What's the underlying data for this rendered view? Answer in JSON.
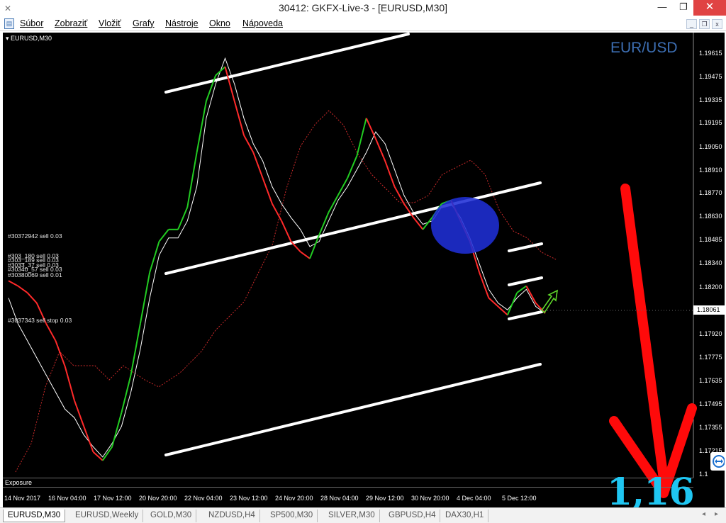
{
  "window": {
    "title": "30412: GKFX-Live-3 - [EURUSD,M30]",
    "icon": "app-icon",
    "controls": {
      "minimize": "—",
      "restore": "❐",
      "close": "✕"
    }
  },
  "menu": {
    "items": [
      "Súbor",
      "Zobraziť",
      "Vložiť",
      "Grafy",
      "Nástroje",
      "Okno",
      "Nápoveda"
    ],
    "mdi": {
      "minimize": "_",
      "restore": "❐",
      "close": "x"
    }
  },
  "chart": {
    "symbol_label": "EURUSD,M30",
    "watermark": "EUR/USD",
    "current_price": "1.18061",
    "exposure_label": "Exposure",
    "overlay_price": "1,16",
    "trade_labels": [
      "#30372942 sell 0.03",
      "#303_180 sell 0.03",
      "#303_189 sell 0.03",
      "#3033_37 sell 0.03",
      "#30340_57 sell 0.03",
      "#30380069 sell 0.01",
      "#3037343 sell stop 0.03"
    ],
    "colors": {
      "background": "#000000",
      "bull_candle": "#22cc22",
      "bear_candle": "#ff2a2a",
      "line": "#ffffff",
      "highlight": "#1f2fd6",
      "arrow": "#ff0a0a",
      "overlay_price": "#1fc6f2"
    }
  },
  "chart_data": {
    "type": "line",
    "title": "",
    "y_ticks": [
      "1.19615",
      "1.19475",
      "1.19335",
      "1.19195",
      "1.19050",
      "1.18910",
      "1.18770",
      "1.18630",
      "1.18485",
      "1.18340",
      "1.18200",
      "1.18061",
      "1.17920",
      "1.17775",
      "1.17635",
      "1.17495",
      "1.17355",
      "1.17215",
      "1.1"
    ],
    "x_ticks": [
      "14 Nov 2017",
      "16 Nov 04:00",
      "17 Nov 12:00",
      "20 Nov 20:00",
      "22 Nov 04:00",
      "23 Nov 12:00",
      "24 Nov 20:00",
      "28 Nov 04:00",
      "29 Nov 12:00",
      "30 Nov 20:00",
      "4 Dec 04:00",
      "5 Dec 12:00"
    ],
    "ylim": [
      1.171,
      1.197
    ],
    "series": [
      {
        "values": [
          1.1815,
          1.18,
          1.179,
          1.178,
          1.177,
          1.176,
          1.175,
          1.1745,
          1.1735,
          1.1728,
          1.1722,
          1.173,
          1.174,
          1.176,
          1.1785,
          1.1815,
          1.184,
          1.185,
          1.185,
          1.186,
          1.188,
          1.192,
          1.194,
          1.1955,
          1.194,
          1.192,
          1.1905,
          1.1895,
          1.188,
          1.187,
          1.1862,
          1.1855,
          1.1845,
          1.1848,
          1.186,
          1.1872,
          1.188,
          1.189,
          1.19,
          1.1912,
          1.1905,
          1.189,
          1.1875,
          1.1865,
          1.1858,
          1.186,
          1.1868,
          1.187,
          1.1862,
          1.185,
          1.1835,
          1.182,
          1.1812,
          1.1808,
          1.1815,
          1.182,
          1.181,
          1.1806
        ]
      },
      {
        "values": [
          1.1825,
          1.1822,
          1.1818,
          1.1812,
          1.18,
          1.179,
          1.1775,
          1.1755,
          1.174,
          1.1725,
          1.172,
          1.1728,
          1.1748,
          1.177,
          1.18,
          1.183,
          1.1848,
          1.1855,
          1.1855,
          1.1868,
          1.19,
          1.193,
          1.1945,
          1.195,
          1.193,
          1.191,
          1.19,
          1.1885,
          1.187,
          1.186,
          1.1848,
          1.1842,
          1.1838,
          1.1852,
          1.1865,
          1.1875,
          1.1885,
          1.1898,
          1.192,
          1.1908,
          1.1895,
          1.188,
          1.187,
          1.1862,
          1.1855,
          1.1862,
          1.187,
          1.1872,
          1.186,
          1.1848,
          1.183,
          1.1815,
          1.181,
          1.1805,
          1.1818,
          1.1822,
          1.1812,
          1.1806
        ]
      }
    ]
  },
  "tabs": {
    "items": [
      "EURUSD,M30",
      "EURUSD,Weekly",
      "GOLD,M30",
      "NZDUSD,H4",
      "SP500,M30",
      "SILVER,M30",
      "GBPUSD,H4",
      "DAX30,H1"
    ],
    "active": "EURUSD,M30",
    "scroll_left": "◂",
    "scroll_right": "▸"
  }
}
